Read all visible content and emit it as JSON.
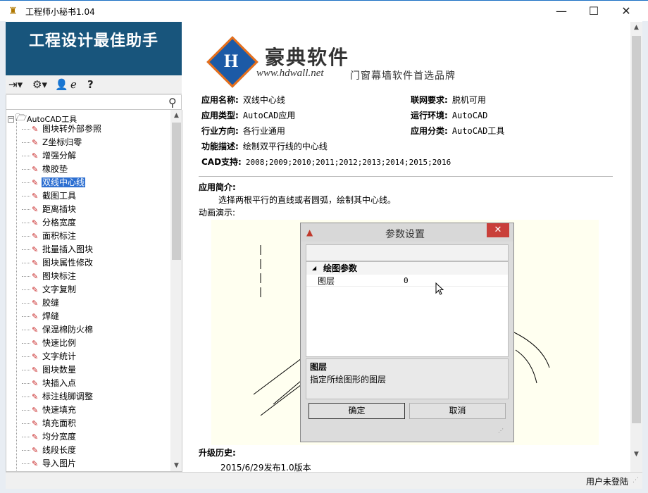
{
  "window": {
    "title": "工程师小秘书1.04",
    "minimize_glyph": "—",
    "maximize_glyph": "☐",
    "close_glyph": "✕",
    "icon": "app-icon"
  },
  "sidebar": {
    "banner": "工程设计最佳助手",
    "toolbar_icons": [
      "logout-icon",
      "settings-icon",
      "user-icon",
      "browser-icon",
      "help-icon"
    ],
    "search_placeholder": "",
    "tree": {
      "root_label": "AutoCAD工具",
      "items": [
        "图块转外部参照",
        "Z坐标归零",
        "增强分解",
        "橡胶垫",
        "双线中心线",
        "截图工具",
        "距离插块",
        "分格宽度",
        "面积标注",
        "批量插入图块",
        "图块属性修改",
        "图块标注",
        "文字复制",
        "胶缝",
        "焊缝",
        "保温棉防火棉",
        "快速比例",
        "文字统计",
        "图块数量",
        "块插入点",
        "标注线脚调整",
        "快速填充",
        "填充面积",
        "均分宽度",
        "线段长度",
        "导入图片"
      ],
      "selected_index": 4
    }
  },
  "logo": {
    "mark_letter": "H",
    "name": "豪典软件",
    "url": "www.hdwall.net",
    "slogan": "门窗幕墙软件首选品牌"
  },
  "info": {
    "app_name_label": "应用名称:",
    "app_name": "双线中心线",
    "app_type_label": "应用类型:",
    "app_type": "AutoCAD应用",
    "industry_label": "行业方向:",
    "industry": "各行业通用",
    "function_label": "功能描述:",
    "function": "绘制双平行线的中心线",
    "cad_label": "CAD支持:",
    "cad": "2008;2009;2010;2011;2012;2013;2014;2015;2016",
    "network_label": "联网要求:",
    "network": "脱机可用",
    "runtime_label": "运行环境:",
    "runtime": "AutoCAD",
    "category_label": "应用分类:",
    "category": "AutoCAD工具"
  },
  "intro": {
    "title": "应用简介:",
    "text": "选择两根平行的直线或者圆弧，绘制其中心线。",
    "demo_label": "动画演示:"
  },
  "dialog": {
    "title": "参数设置",
    "close_glyph": "✕",
    "category": "绘图参数",
    "property_name": "图层",
    "property_value": "0",
    "desc_title": "图层",
    "desc_text": "指定所绘图形的图层",
    "ok_label": "确定",
    "cancel_label": "取消"
  },
  "history": {
    "title": "升级历史:",
    "items": [
      "2015/6/29发布1.0版本"
    ]
  },
  "status": {
    "login": "用户未登陆"
  }
}
